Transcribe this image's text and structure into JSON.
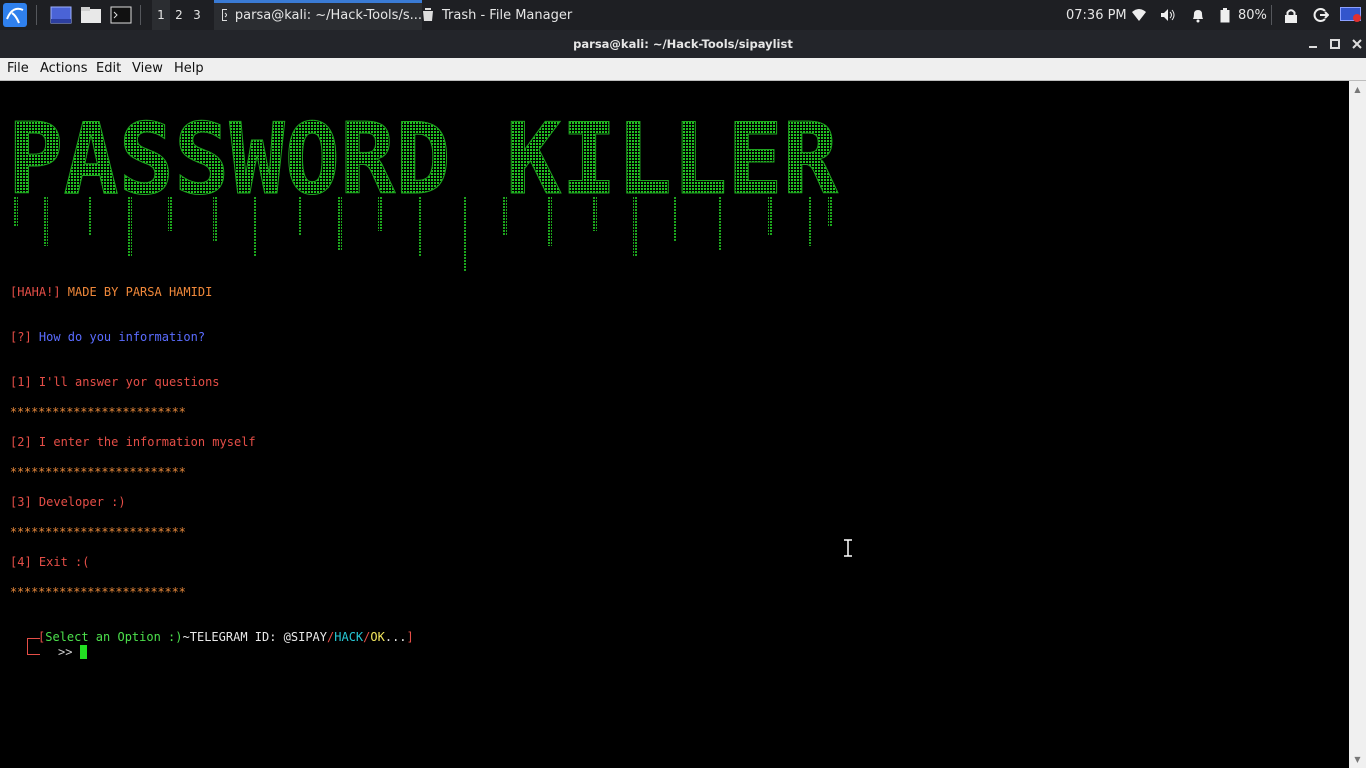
{
  "panel": {
    "workspaces": [
      "1",
      "2",
      "3"
    ],
    "tasks": [
      {
        "label": "parsa@kali: ~/Hack-Tools/s...",
        "icon": "terminal-icon"
      },
      {
        "label": "Trash - File Manager",
        "icon": "trash-icon"
      }
    ],
    "clock": "07:36 PM",
    "battery": "80%"
  },
  "window": {
    "title": "parsa@kali: ~/Hack-Tools/sipaylist"
  },
  "menu": [
    "File",
    "Actions",
    "Edit",
    "View",
    "Help"
  ],
  "terminal": {
    "banner": "PASSWORD KILLER",
    "haha_tag": "[HAHA!]",
    "made_by": " MADE BY PARSA HAMIDI",
    "question_tag": "[?]",
    "question": " How do you information?",
    "option1": "[1] I'll answer yor questions",
    "option2": "[2] I enter the information myself",
    "option3": "[3] Developer :)",
    "option4": "[4] Exit :(",
    "stars": "*************************",
    "prompt": {
      "open": "[",
      "select": "Select an Option :)",
      "tele": "~TELEGRAM ID: @SIPAY",
      "slash1": "/",
      "hack": "HACK",
      "slash2": "/",
      "ok": "OK",
      "dots": "...",
      "close": "]",
      "arrow": "──╼",
      "input": ">>"
    }
  },
  "colors": {
    "banner_green": "#22c222",
    "red": "#e54e47",
    "orange": "#f0883a",
    "blue": "#5a6cff",
    "cyan": "#27c7d4",
    "yellow": "#f3e65d"
  }
}
